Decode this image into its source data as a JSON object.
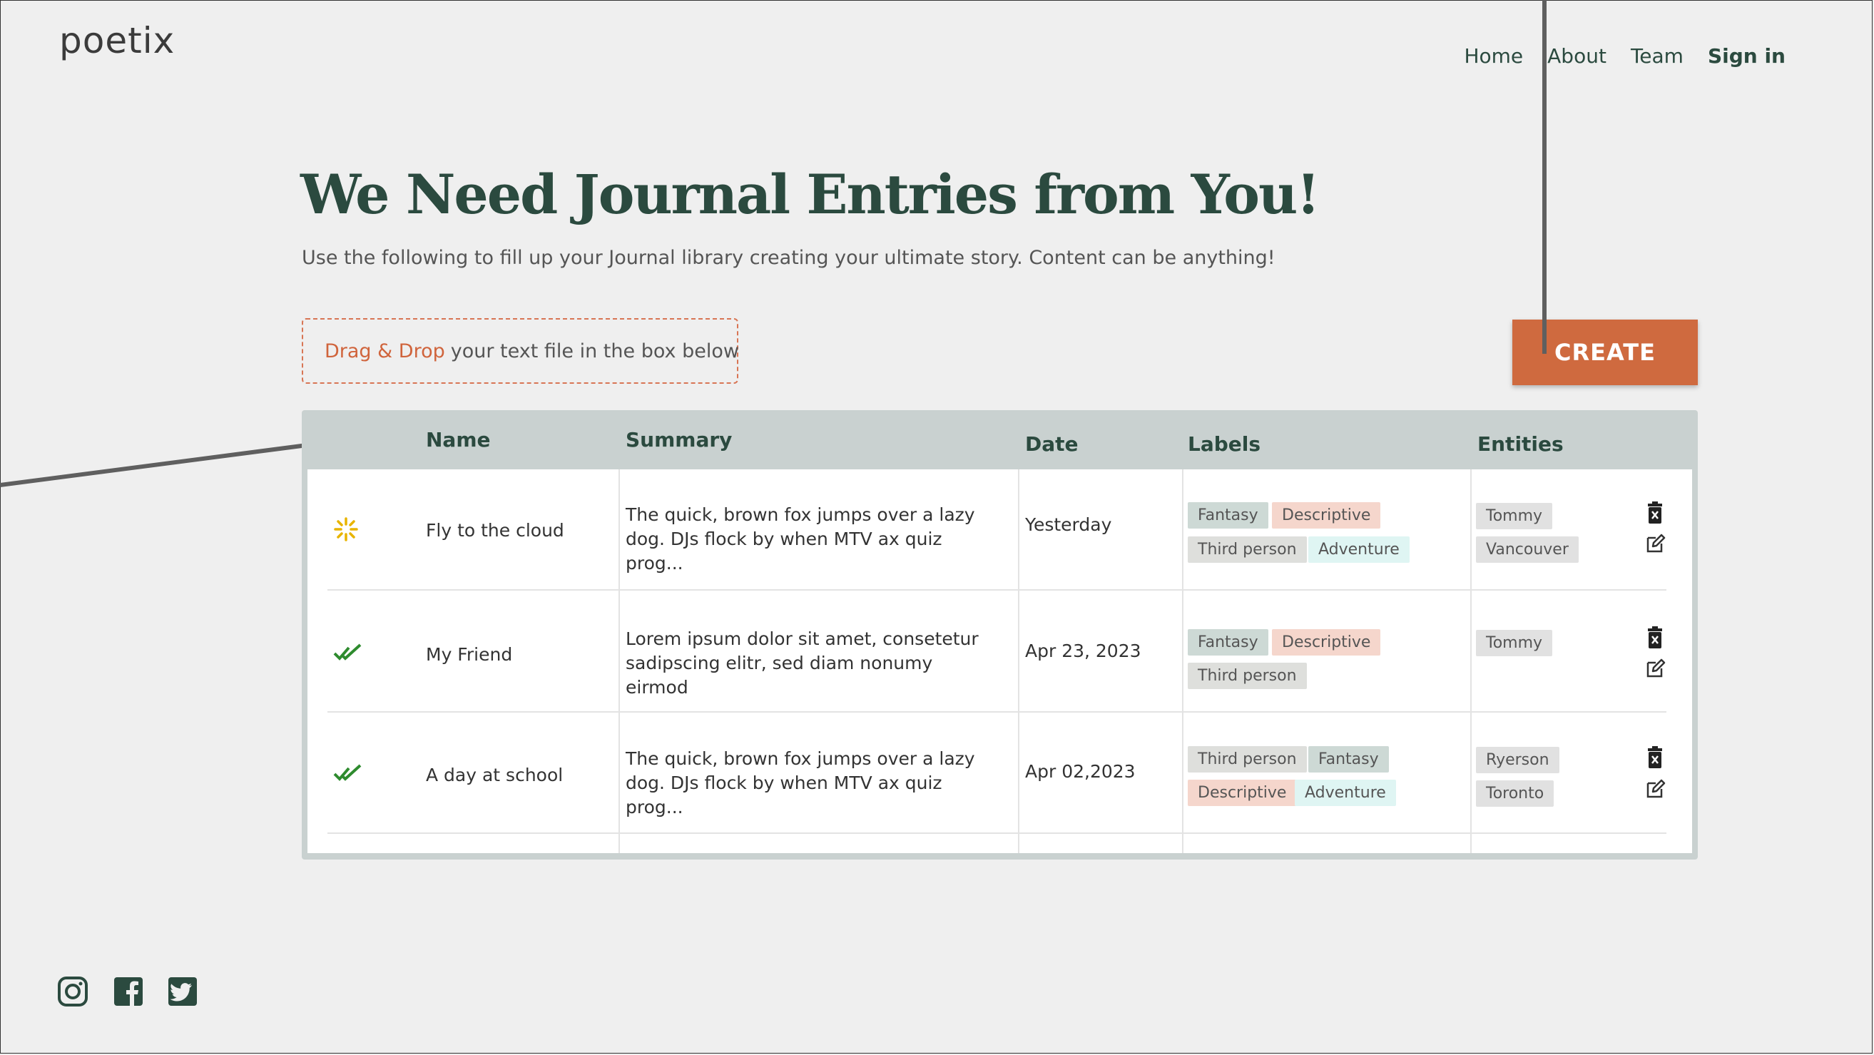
{
  "brand": {
    "logo": "poetix"
  },
  "nav": {
    "home": "Home",
    "about": "About",
    "team": "Team",
    "signin": "Sign in"
  },
  "hero": {
    "title": "We Need Journal Entries from You!",
    "subtitle": "Use the following to fill up your Journal library creating your ultimate story. Content can be anything!"
  },
  "dropzone": {
    "accent": "Drag & Drop",
    "text": "your text file in the box below"
  },
  "create_button": {
    "label": "CREATE"
  },
  "table": {
    "headers": {
      "name": "Name",
      "summary": "Summary",
      "date": "Date",
      "labels": "Labels",
      "entities": "Entities"
    },
    "rows": [
      {
        "status": "loading-icon",
        "name": "Fly to the cloud",
        "summary_line1": "The quick, brown fox jumps over a lazy",
        "summary_line2": "dog. DJs flock by when MTV ax quiz prog...",
        "date": "Yesterday",
        "labels": [
          "Fantasy",
          "Descriptive",
          "Third person",
          "Adventure"
        ],
        "entities": [
          "Tommy",
          "Vancouver"
        ]
      },
      {
        "status": "double-check-icon",
        "name": "My Friend",
        "summary_line1": "Lorem ipsum dolor sit amet, consetetur",
        "summary_line2": "sadipscing elitr, sed diam nonumy eirmod",
        "date": "Apr 23, 2023",
        "labels": [
          "Fantasy",
          "Descriptive",
          "Third person"
        ],
        "entities": [
          "Tommy"
        ]
      },
      {
        "status": "double-check-icon",
        "name": "A day at school",
        "summary_line1": "The quick, brown fox jumps over a lazy",
        "summary_line2": "dog. DJs flock by when MTV ax quiz prog...",
        "date": "Apr 02,2023",
        "labels": [
          "Third person",
          "Fantasy",
          "Descriptive",
          "Adventure"
        ],
        "entities": [
          "Ryerson",
          "Toronto"
        ]
      }
    ]
  },
  "colors": {
    "accent": "#cf6a3f",
    "heading": "#2b4a3f",
    "background": "#efefef",
    "table_header": "#c9d1d0",
    "check_green": "#2e8b2e",
    "loading_yellow": "#e8b400"
  },
  "social": [
    "instagram-icon",
    "facebook-icon",
    "twitter-icon"
  ]
}
